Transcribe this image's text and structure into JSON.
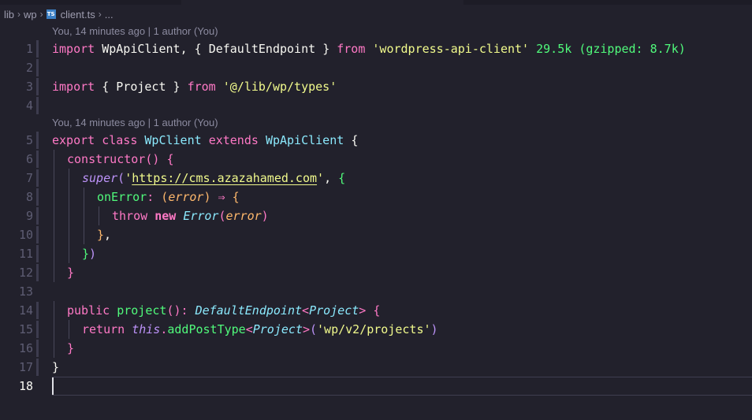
{
  "breadcrumb": {
    "items": [
      "lib",
      "wp"
    ],
    "file_icon": "TS",
    "file": "client.ts",
    "ellipsis": "..."
  },
  "codelens": [
    "You, 14 minutes ago | 1 author (You)",
    "You, 14 minutes ago | 1 author (You)"
  ],
  "import_size": {
    "size": "29.5k",
    "gzip": "(gzipped: 8.7k)"
  },
  "lines": [
    {
      "n": "1"
    },
    {
      "n": "2"
    },
    {
      "n": "3"
    },
    {
      "n": "4"
    },
    {
      "n": "5"
    },
    {
      "n": "6"
    },
    {
      "n": "7"
    },
    {
      "n": "8"
    },
    {
      "n": "9"
    },
    {
      "n": "10"
    },
    {
      "n": "11"
    },
    {
      "n": "12"
    },
    {
      "n": "13"
    },
    {
      "n": "14"
    },
    {
      "n": "15"
    },
    {
      "n": "16"
    },
    {
      "n": "17"
    },
    {
      "n": "18"
    }
  ],
  "code": {
    "l1": {
      "kw_import": "import",
      "default": "WpApiClient",
      "comma": ",",
      "ob": "{",
      "named": "DefaultEndpoint",
      "cb": "}",
      "kw_from": "from",
      "module": "'wordpress-api-client'"
    },
    "l3": {
      "kw_import": "import",
      "ob": "{",
      "named": "Project",
      "cb": "}",
      "kw_from": "from",
      "module": "'@/lib/wp/types'"
    },
    "l5": {
      "kw_export": "export",
      "kw_class": "class",
      "name": "WpClient",
      "kw_extends": "extends",
      "base": "WpApiClient",
      "ob": "{"
    },
    "l6": {
      "name": "constructor",
      "parens": "()",
      "ob": "{"
    },
    "l7": {
      "name": "super",
      "op": "(",
      "q1": "'",
      "url": "https://cms.azazahamed.com",
      "q2": "'",
      "comma": ",",
      "ob": "{"
    },
    "l8": {
      "prop": "onError",
      "colon": ":",
      "op": "(",
      "param": "error",
      "cp": ")",
      "arrow": "⇒",
      "ob": "{"
    },
    "l9": {
      "kw_throw": "throw",
      "kw_new": "new",
      "cls": "Error",
      "op": "(",
      "param": "error",
      "cp": ")"
    },
    "l10": {
      "cb": "}",
      "comma": ","
    },
    "l11": {
      "cb": "}",
      "cp": ")"
    },
    "l12": {
      "cb": "}"
    },
    "l14": {
      "kw_public": "public",
      "name": "project",
      "parens": "()",
      "colon": ":",
      "ret": "DefaultEndpoint",
      "lt": "<",
      "targ": "Project",
      "gt": ">",
      "ob": "{"
    },
    "l15": {
      "kw_return": "return",
      "kw_this": "this",
      "dot": ".",
      "method": "addPostType",
      "lt": "<",
      "targ": "Project",
      "gt": ">",
      "op": "(",
      "arg": "'wp/v2/projects'",
      "cp": ")"
    },
    "l16": {
      "cb": "}"
    },
    "l17": {
      "cb": "}"
    }
  },
  "colors": {
    "background": "#22212c",
    "keyword": "#ff79c6",
    "class": "#8be9fd",
    "string": "#f1fa8c",
    "function": "#50fa7b",
    "param": "#ffb86c",
    "italic": "#bd93f9"
  }
}
